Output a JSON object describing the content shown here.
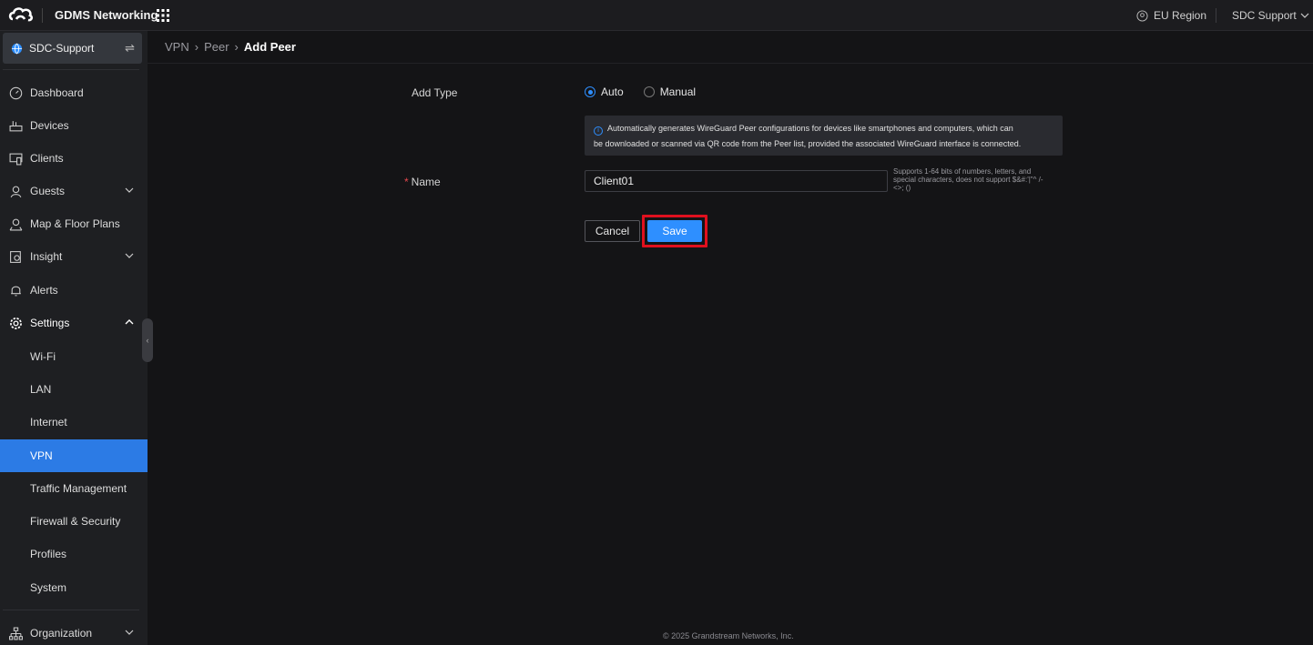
{
  "topbar": {
    "brand": "GDMS Networking",
    "region": "EU Region",
    "account": "SDC Support"
  },
  "sidebar": {
    "site": "SDC-Support",
    "items": [
      {
        "label": "Dashboard",
        "icon": "dashboard-icon"
      },
      {
        "label": "Devices",
        "icon": "devices-icon"
      },
      {
        "label": "Clients",
        "icon": "clients-icon"
      },
      {
        "label": "Guests",
        "icon": "guests-icon"
      },
      {
        "label": "Map & Floor Plans",
        "icon": "map-icon"
      },
      {
        "label": "Insight",
        "icon": "insight-icon"
      },
      {
        "label": "Alerts",
        "icon": "bell-icon"
      },
      {
        "label": "Settings",
        "icon": "gear-icon"
      }
    ],
    "settings_sub": [
      "Wi-Fi",
      "LAN",
      "Internet",
      "VPN",
      "Traffic Management",
      "Firewall & Security",
      "Profiles",
      "System"
    ],
    "active_sub": "VPN",
    "organization": "Organization"
  },
  "breadcrumb": [
    "VPN",
    "Peer",
    "Add Peer"
  ],
  "form": {
    "add_type_label": "Add Type",
    "options": [
      "Auto",
      "Manual"
    ],
    "selected": "Auto",
    "info_line1": "Automatically generates WireGuard Peer configurations for devices like smartphones and computers, which can",
    "info_line2": "be downloaded or scanned via QR code from the Peer list, provided the associated WireGuard interface is connected.",
    "name_label": "Name",
    "name_value": "Client01",
    "name_hint": "Supports 1-64 bits of numbers, letters, and special characters, does not support $&#:'|\"^ /- <>; ()",
    "cancel": "Cancel",
    "save": "Save"
  },
  "footer": "© 2025 Grandstream Networks, Inc.",
  "colors": {
    "accent": "#2e8fff",
    "active_nav": "#2c7be5",
    "highlight": "#e0101e"
  }
}
